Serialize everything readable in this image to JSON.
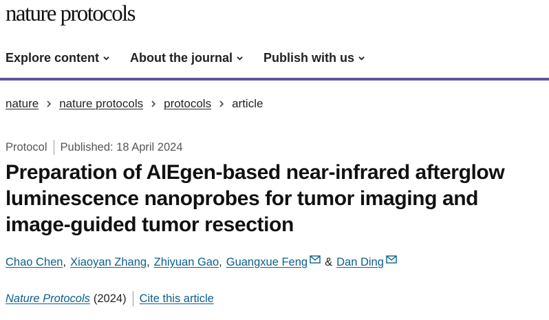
{
  "site": {
    "logo": "nature protocols"
  },
  "nav": {
    "items": [
      {
        "label": "Explore content"
      },
      {
        "label": "About the journal"
      },
      {
        "label": "Publish with us"
      }
    ]
  },
  "breadcrumb": {
    "items": [
      {
        "label": "nature"
      },
      {
        "label": "nature protocols"
      },
      {
        "label": "protocols"
      },
      {
        "label": "article"
      }
    ]
  },
  "article": {
    "type": "Protocol",
    "published": "Published: 18 April 2024",
    "title_lines": [
      "Preparation of AIEgen-based near-infrared afterglow",
      "luminescence nanoprobes for tumor imaging and",
      "image-guided tumor resection"
    ],
    "authors": [
      {
        "name": "Chao Chen"
      },
      {
        "name": "Xiaoyan Zhang"
      },
      {
        "name": "Zhiyuan Gao"
      },
      {
        "name": "Guangxue Feng"
      },
      {
        "name": "Dan Ding"
      }
    ],
    "journal": "Nature Protocols",
    "year": "(2024)",
    "cite_label": "Cite this article"
  },
  "colors": {
    "accent_rule": "#5a5695",
    "link": "#0a5f8a"
  },
  "icons": [
    "chevron-down-icon",
    "chevron-right-icon",
    "mail-icon"
  ]
}
